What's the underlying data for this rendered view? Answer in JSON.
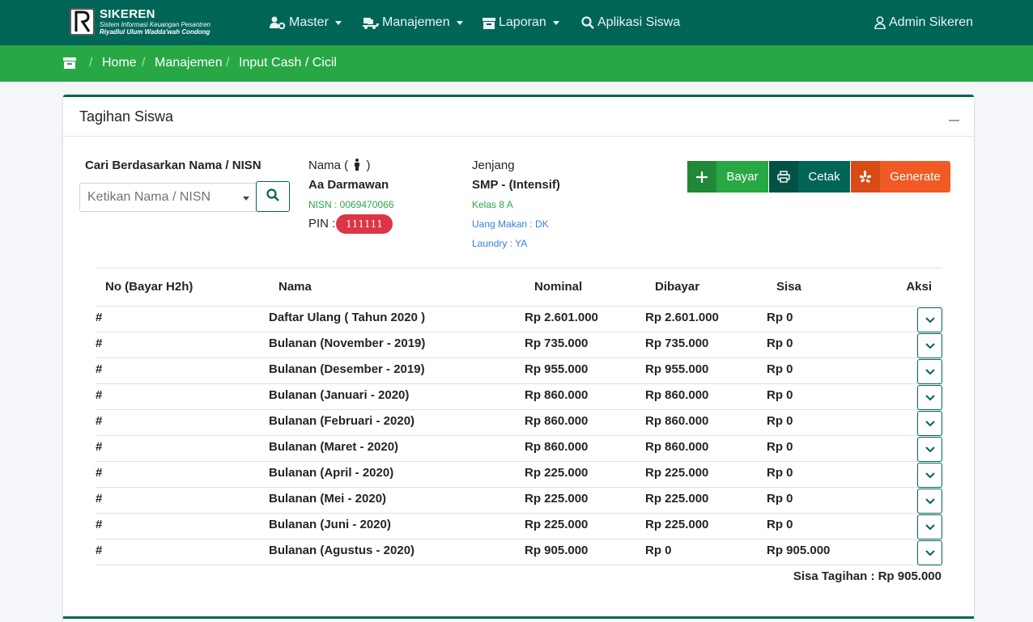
{
  "brand": {
    "name": "SIKEREN",
    "subtitle": "Sistem Informasi Keuangan Pesantren",
    "subtitle2": "Riyadlul Ulum Wadda'wah Condong"
  },
  "nav": {
    "items": [
      {
        "label": "Master",
        "icon": "users-cog-icon"
      },
      {
        "label": "Manajemen",
        "icon": "truck-loading-icon"
      },
      {
        "label": "Laporan",
        "icon": "archive-icon"
      },
      {
        "label": "Aplikasi Siswa",
        "icon": "search-icon"
      }
    ],
    "user": "Admin Sikeren"
  },
  "breadcrumb": {
    "items": [
      "Home",
      "Manajemen",
      "Input Cash / Cicil"
    ]
  },
  "card": {
    "title": "Tagihan Siswa"
  },
  "search": {
    "label": "Cari Berdasarkan Nama / NISN",
    "placeholder": "Ketikan Nama / NISN"
  },
  "student": {
    "nama_label": "Nama (",
    "nama_label_end": ")",
    "nama": "Aa Darmawan",
    "nisn": "NISN : 0069470066",
    "pin_label": "PIN :",
    "pin": "111111",
    "jenjang_label": "Jenjang",
    "jenjang": "SMP - (Intensif)",
    "kelas": "Kelas 8 A",
    "uang_makan": "Uang Makan : DK",
    "laundry": "Laundry : YA"
  },
  "actions": {
    "bayar": "Bayar",
    "cetak": "Cetak",
    "generate": "Generate"
  },
  "table": {
    "headers": [
      "No (Bayar H2h)",
      "Nama",
      "Nominal",
      "Dibayar",
      "Sisa",
      "Aksi"
    ],
    "rows": [
      {
        "no": "#",
        "nama": "Daftar Ulang ( Tahun 2020 )",
        "nominal": "Rp 2.601.000",
        "dibayar": "Rp 2.601.000",
        "sisa": "Rp 0"
      },
      {
        "no": "#",
        "nama": "Bulanan (November - 2019)",
        "nominal": "Rp 735.000",
        "dibayar": "Rp 735.000",
        "sisa": "Rp 0"
      },
      {
        "no": "#",
        "nama": "Bulanan (Desember - 2019)",
        "nominal": "Rp 955.000",
        "dibayar": "Rp 955.000",
        "sisa": "Rp 0"
      },
      {
        "no": "#",
        "nama": "Bulanan (Januari - 2020)",
        "nominal": "Rp 860.000",
        "dibayar": "Rp 860.000",
        "sisa": "Rp 0"
      },
      {
        "no": "#",
        "nama": "Bulanan (Februari - 2020)",
        "nominal": "Rp 860.000",
        "dibayar": "Rp 860.000",
        "sisa": "Rp 0"
      },
      {
        "no": "#",
        "nama": "Bulanan (Maret - 2020)",
        "nominal": "Rp 860.000",
        "dibayar": "Rp 860.000",
        "sisa": "Rp 0"
      },
      {
        "no": "#",
        "nama": "Bulanan (April - 2020)",
        "nominal": "Rp 225.000",
        "dibayar": "Rp 225.000",
        "sisa": "Rp 0"
      },
      {
        "no": "#",
        "nama": "Bulanan (Mei - 2020)",
        "nominal": "Rp 225.000",
        "dibayar": "Rp 225.000",
        "sisa": "Rp 0"
      },
      {
        "no": "#",
        "nama": "Bulanan (Juni - 2020)",
        "nominal": "Rp 225.000",
        "dibayar": "Rp 225.000",
        "sisa": "Rp 0"
      },
      {
        "no": "#",
        "nama": "Bulanan (Agustus - 2020)",
        "nominal": "Rp 905.000",
        "dibayar": "Rp 0",
        "sisa": "Rp 905.000"
      }
    ],
    "summary": "Sisa Tagihan : Rp 905.000"
  },
  "colors": {
    "primary": "#006557",
    "success": "#28a745",
    "danger": "#dc3545",
    "generate": "#f15a24"
  }
}
